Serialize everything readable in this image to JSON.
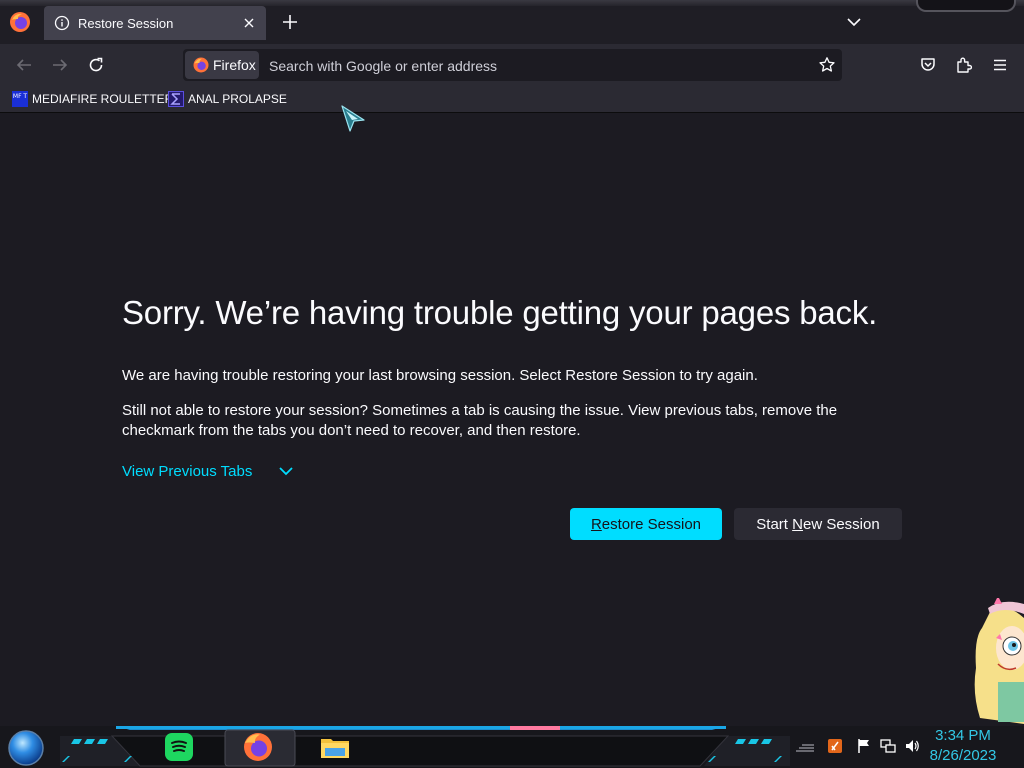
{
  "tab": {
    "title": "Restore Session"
  },
  "navbar": {
    "identity_label": "Firefox",
    "url_placeholder": "Search with Google or enter address",
    "url_value": ""
  },
  "bookmarks": [
    {
      "label": "MEDIAFIRE ROULETTER",
      "favicon_text": "MF T"
    },
    {
      "label": "ANAL PROLAPSE"
    }
  ],
  "content": {
    "heading": "Sorry. We’re having trouble getting your pages back.",
    "paragraph1": "We are having trouble restoring your last browsing session. Select Restore Session to try again.",
    "paragraph2": "Still not able to restore your session? Sometimes a tab is causing the issue. View previous tabs, remove the checkmark from the tabs you don’t need to recover, and then restore.",
    "view_tabs_label": "View Previous Tabs",
    "restore_button": {
      "accel": "R",
      "rest": "estore Session"
    },
    "new_session_button": {
      "before": "Start ",
      "accel": "N",
      "after": "ew Session"
    }
  },
  "taskbar": {
    "time": "3:34 PM",
    "date": "8/26/2023",
    "apps": [
      "spotify-icon",
      "firefox-icon",
      "file-explorer-icon"
    ],
    "tray": [
      "app-tray-icon",
      "flag-icon",
      "network-icon",
      "volume-icon"
    ]
  },
  "colors": {
    "accent": "#00ddff",
    "background": "#1c1b22",
    "toolbar": "#2b2a33",
    "clock": "#33c8e6"
  }
}
